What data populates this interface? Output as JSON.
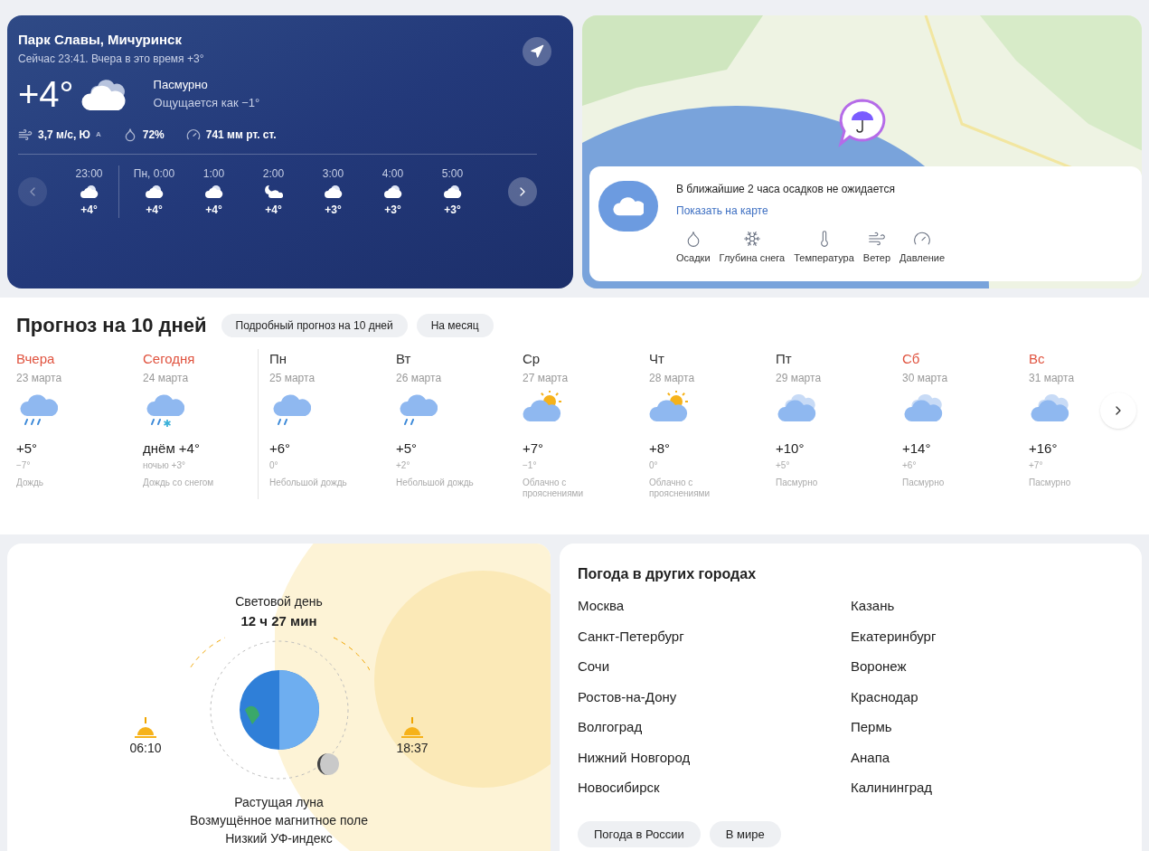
{
  "current": {
    "location": "Парк Славы, Мичуринск",
    "subtitle": "Сейчас 23:41. Вчера в это время +3°",
    "temperature": "+4°",
    "condition": "Пасмурно",
    "feels_like": "Ощущается как −1°",
    "wind": "3,7 м/с, Ю",
    "wind_dir": "A",
    "humidity": "72%",
    "pressure": "741 мм рт. ст."
  },
  "hourly": [
    {
      "time": "23:00",
      "temp": "+4°",
      "kind": "night-cloudy",
      "divider_after": true
    },
    {
      "time": "Пн, 0:00",
      "temp": "+4°",
      "kind": "night-cloudy",
      "divider_after": false
    },
    {
      "time": "1:00",
      "temp": "+4°",
      "kind": "night-cloudy",
      "divider_after": false
    },
    {
      "time": "2:00",
      "temp": "+4°",
      "kind": "night-clear",
      "divider_after": false
    },
    {
      "time": "3:00",
      "temp": "+3°",
      "kind": "night-cloudy",
      "divider_after": false
    },
    {
      "time": "4:00",
      "temp": "+3°",
      "kind": "night-cloudy",
      "divider_after": false
    },
    {
      "time": "5:00",
      "temp": "+3°",
      "kind": "night-cloudy",
      "divider_after": false
    }
  ],
  "nowcast": {
    "message": "В ближайшие 2 часа осадков не ожидается",
    "link": "Показать на карте",
    "layers": [
      {
        "label": "Осадки",
        "kind": "precip"
      },
      {
        "label": "Глубина снега",
        "kind": "snow"
      },
      {
        "label": "Температура",
        "kind": "temp"
      },
      {
        "label": "Ветер",
        "kind": "wind"
      },
      {
        "label": "Давление",
        "kind": "pressure"
      }
    ]
  },
  "forecast": {
    "title": "Прогноз на 10 дней",
    "buttons": [
      "Подробный прогноз на 10 дней",
      "На месяц"
    ],
    "days": [
      {
        "day": "Вчера",
        "date": "23 марта",
        "kind": "rain",
        "temp": "+5°",
        "night": "−7°",
        "condition": "Дождь",
        "weekend": true,
        "divider_after": false
      },
      {
        "day": "Сегодня",
        "date": "24 марта",
        "kind": "rain-snow",
        "temp": "днём +4°",
        "night": "ночью +3°",
        "condition": "Дождь со снегом",
        "weekend": true,
        "divider_after": true
      },
      {
        "day": "Пн",
        "date": "25 марта",
        "kind": "light-rain",
        "temp": "+6°",
        "night": "0°",
        "condition": "Небольшой дождь",
        "weekend": false,
        "divider_after": false
      },
      {
        "day": "Вт",
        "date": "26 марта",
        "kind": "light-rain",
        "temp": "+5°",
        "night": "+2°",
        "condition": "Небольшой дождь",
        "weekend": false,
        "divider_after": false
      },
      {
        "day": "Ср",
        "date": "27 марта",
        "kind": "partly-cloudy",
        "temp": "+7°",
        "night": "−1°",
        "condition": "Облачно с прояснениями",
        "weekend": false,
        "divider_after": false
      },
      {
        "day": "Чт",
        "date": "28 марта",
        "kind": "partly-cloudy",
        "temp": "+8°",
        "night": "0°",
        "condition": "Облачно с прояснениями",
        "weekend": false,
        "divider_after": false
      },
      {
        "day": "Пт",
        "date": "29 марта",
        "kind": "overcast",
        "temp": "+10°",
        "night": "+5°",
        "condition": "Пасмурно",
        "weekend": false,
        "divider_after": false
      },
      {
        "day": "Сб",
        "date": "30 марта",
        "kind": "overcast",
        "temp": "+14°",
        "night": "+6°",
        "condition": "Пасмурно",
        "weekend": true,
        "divider_after": false
      },
      {
        "day": "Вс",
        "date": "31 марта",
        "kind": "overcast",
        "temp": "+16°",
        "night": "+7°",
        "condition": "Пасмурно",
        "weekend": true,
        "divider_after": false
      }
    ]
  },
  "daylight": {
    "label": "Световой день",
    "duration": "12 ч 27 мин",
    "sunrise": "06:10",
    "sunset": "18:37",
    "notes": [
      "Растущая луна",
      "Возмущённое магнитное поле",
      "Низкий УФ-индекс"
    ]
  },
  "other_cities": {
    "title": "Погода в других городах",
    "columns": [
      [
        "Москва",
        "Санкт-Петербург",
        "Сочи",
        "Ростов-на-Дону",
        "Волгоград",
        "Нижний Новгород",
        "Новосибирск"
      ],
      [
        "Казань",
        "Екатеринбург",
        "Воронеж",
        "Краснодар",
        "Пермь",
        "Анапа",
        "Калининград"
      ]
    ],
    "buttons": [
      "Погода в России",
      "В мире"
    ]
  }
}
